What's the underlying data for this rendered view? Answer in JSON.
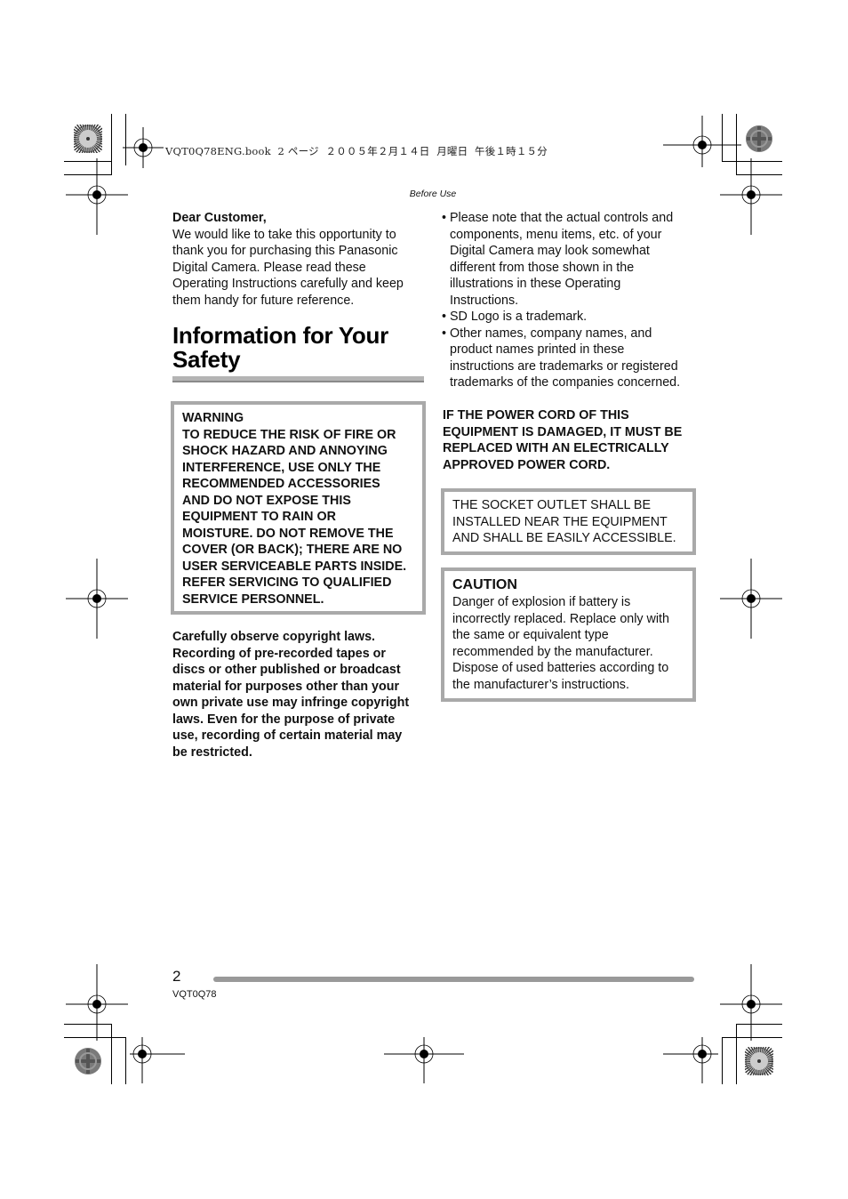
{
  "print_header": {
    "file_info": "VQT0Q78ENG.book  2 ページ  ２００５年２月１４日  月曜日  午後１時１５分"
  },
  "section_label": "Before Use",
  "left_column": {
    "greeting": "Dear Customer,",
    "intro_lines": [
      "We would like to take this opportunity to",
      "thank you for purchasing this Panasonic",
      "Digital Camera. Please read these",
      "Operating Instructions carefully and keep",
      "them handy for future reference."
    ],
    "title_lines": [
      "Information for Your",
      "Safety"
    ],
    "warning_box": {
      "lines": [
        "WARNING",
        "TO REDUCE THE RISK OF FIRE OR",
        "SHOCK HAZARD AND ANNOYING",
        "INTERFERENCE, USE ONLY THE",
        "RECOMMENDED ACCESSORIES",
        "AND DO NOT EXPOSE THIS",
        "EQUIPMENT TO RAIN OR",
        "MOISTURE. DO NOT REMOVE THE",
        "COVER (OR BACK); THERE ARE NO",
        "USER SERVICEABLE PARTS INSIDE.",
        "REFER SERVICING TO QUALIFIED",
        "SERVICE PERSONNEL."
      ]
    },
    "copyright_lines": [
      "Carefully observe copyright laws.",
      "Recording of pre-recorded tapes or",
      "discs or other published or broadcast",
      "material for purposes other than your",
      "own private use may infringe copyright",
      "laws. Even for the purpose of private",
      "use, recording of certain material may",
      "be restricted."
    ]
  },
  "right_column": {
    "bullet_symbol": "•",
    "bullets": [
      {
        "lines": [
          "Please note that the actual controls and",
          "components, menu items, etc. of your",
          "Digital Camera may look somewhat",
          "different from those shown in the",
          "illustrations in these Operating",
          "Instructions."
        ]
      },
      {
        "lines": [
          "SD Logo is a trademark."
        ]
      },
      {
        "lines": [
          "Other names, company names, and",
          "product names printed in these",
          "instructions are trademarks or registered",
          "trademarks of the companies concerned."
        ]
      }
    ],
    "power_cord_lines": [
      "IF THE POWER CORD OF THIS",
      "EQUIPMENT IS DAMAGED, IT MUST BE",
      "REPLACED WITH AN ELECTRICALLY",
      "APPROVED POWER CORD."
    ],
    "socket_box_lines": [
      "THE SOCKET OUTLET SHALL BE",
      "INSTALLED NEAR THE EQUIPMENT",
      "AND SHALL BE EASILY ACCESSIBLE."
    ],
    "caution_box": {
      "heading": "CAUTION",
      "lines": [
        "Danger of explosion if battery is",
        "incorrectly replaced. Replace only with",
        "the same or equivalent type",
        "recommended by the manufacturer.",
        "Dispose of used batteries according to",
        "the manufacturer’s instructions."
      ]
    }
  },
  "footer": {
    "page_number": "2",
    "model_code": "VQT0Q78"
  },
  "colors": {
    "box_border": "#a9a9a9",
    "rule_gray": "#999999",
    "text": "#111111"
  }
}
